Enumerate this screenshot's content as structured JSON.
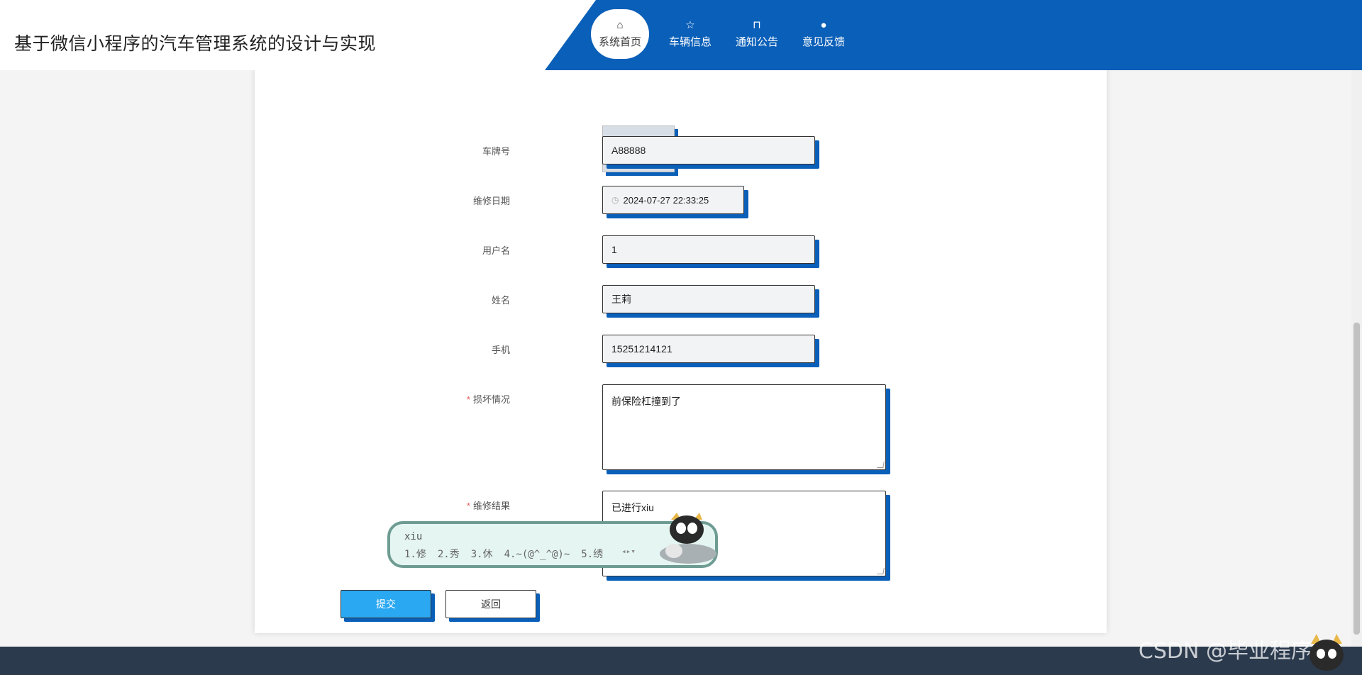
{
  "app_title": "基于微信小程序的汽车管理系统的设计与实现",
  "nav": [
    {
      "icon": "home-icon",
      "glyph": "⌂",
      "label": "系统首页",
      "active": true
    },
    {
      "icon": "star-icon",
      "glyph": "☆",
      "label": "车辆信息"
    },
    {
      "icon": "bag-icon",
      "glyph": "⊓",
      "label": "通知公告"
    },
    {
      "icon": "alert-icon",
      "glyph": "●",
      "label": "意见反馈"
    }
  ],
  "form": {
    "plate": {
      "label": "车牌号",
      "value": "A88888"
    },
    "repair_date": {
      "label": "维修日期",
      "value": "2024-07-27 22:33:25"
    },
    "username": {
      "label": "用户名",
      "value": "1"
    },
    "name": {
      "label": "姓名",
      "value": "王莉"
    },
    "phone": {
      "label": "手机",
      "value": "15251214121"
    },
    "damage": {
      "label": "损坏情况",
      "required_mark": "*",
      "value": "前保险杠撞到了"
    },
    "result": {
      "label": "维修结果",
      "required_mark": "*",
      "value": "已进行xiu"
    }
  },
  "buttons": {
    "submit": "提交",
    "back": "返回"
  },
  "ime": {
    "typed": "xiu",
    "candidates": [
      "1.修",
      "2.秀",
      "3.休",
      "4.~(@^_^@)~",
      "5.绣"
    ]
  },
  "watermark": "CSDN @毕业程序员",
  "colors": {
    "brand_blue": "#0a5fb8",
    "submit_blue": "#2aa8f2",
    "footer": "#2b3a4d"
  }
}
